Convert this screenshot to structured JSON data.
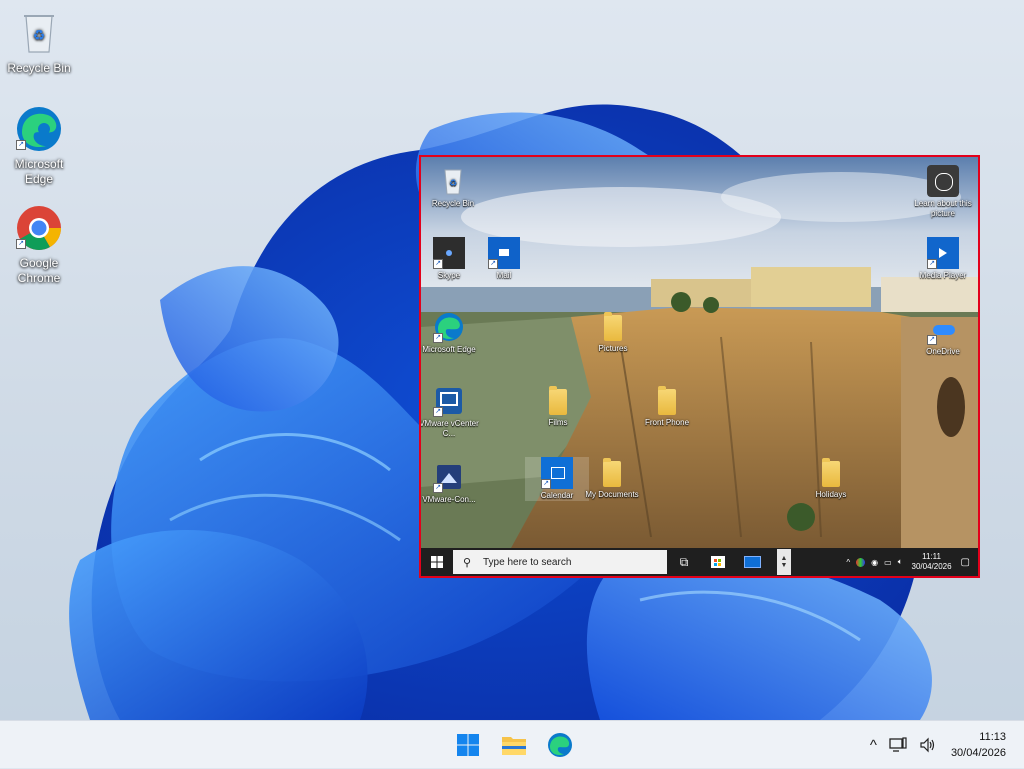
{
  "host": {
    "desktop_icons": [
      {
        "label": "Recycle Bin",
        "icon": "recycle-bin-icon"
      },
      {
        "label": "Microsoft Edge",
        "icon": "edge-icon"
      },
      {
        "label": "Google Chrome",
        "icon": "chrome-icon"
      }
    ],
    "taskbar": {
      "buttons": [
        {
          "name": "start-button",
          "icon": "windows-logo-icon"
        },
        {
          "name": "file-explorer-button",
          "icon": "folder-icon"
        },
        {
          "name": "edge-taskbar-button",
          "icon": "edge-icon"
        }
      ],
      "tray": {
        "chevron": "^",
        "time": "11:13",
        "date": "30/04/2026"
      }
    }
  },
  "remote": {
    "accent_border": "#e3001b",
    "desktop_icons": [
      {
        "label": "Recycle Bin",
        "icon": "recycle-bin-icon"
      },
      {
        "label": "Skype",
        "icon": "skype-icon"
      },
      {
        "label": "Mail",
        "icon": "mail-icon"
      },
      {
        "label": "Microsoft Edge",
        "icon": "edge-icon"
      },
      {
        "label": "VMware vCenter C...",
        "icon": "vmware-icon"
      },
      {
        "label": "VMware-Con...",
        "icon": "vmware-console-icon"
      },
      {
        "label": "Pictures",
        "icon": "folder-icon"
      },
      {
        "label": "Films",
        "icon": "folder-icon"
      },
      {
        "label": "Front Phone",
        "icon": "folder-icon"
      },
      {
        "label": "Calendar",
        "icon": "calendar-icon"
      },
      {
        "label": "My Documents",
        "icon": "folder-icon"
      },
      {
        "label": "Holidays",
        "icon": "folder-icon"
      },
      {
        "label": "Learn about this picture",
        "icon": "camera-icon"
      },
      {
        "label": "Media Player",
        "icon": "media-player-icon"
      },
      {
        "label": "OneDrive",
        "icon": "onedrive-icon"
      }
    ],
    "taskbar": {
      "search_placeholder": "Type here to search",
      "time": "11:11",
      "date": "30/04/2026"
    }
  }
}
